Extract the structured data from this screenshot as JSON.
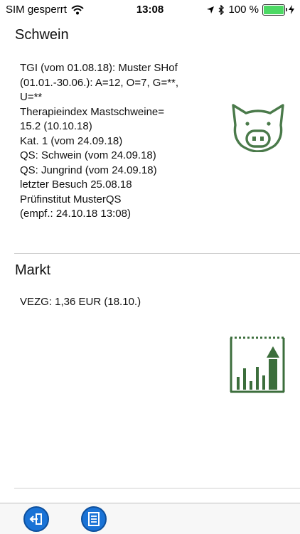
{
  "status_bar": {
    "carrier": "SIM gesperrt",
    "time": "13:08",
    "battery_percent": "100 %",
    "battery_level": 1.0
  },
  "schwein": {
    "title": "Schwein",
    "lines": [
      "TGI (vom 01.08.18): Muster SHof",
      "(01.01.-30.06.): A=12, O=7, G=**,",
      "U=**",
      "Therapieindex Mastschweine=",
      "15.2 (10.10.18)",
      "Kat. 1  (vom 24.09.18)",
      "QS: Schwein  (vom 24.09.18)",
      "QS: Jungrind  (vom 24.09.18)",
      "letzter Besuch 25.08.18",
      "Prüfinstitut MusterQS",
      "(empf.: 24.10.18 13:08)"
    ]
  },
  "markt": {
    "title": "Markt",
    "vezg": "VEZG: 1,36  EUR (18.10.)"
  },
  "icons": {
    "pig": "pig-icon",
    "market": "market-chart-icon",
    "logout": "logout-icon",
    "list": "list-icon"
  },
  "colors": {
    "icon_green": "#4a7a4a",
    "tab_blue": "#1a73d6"
  }
}
